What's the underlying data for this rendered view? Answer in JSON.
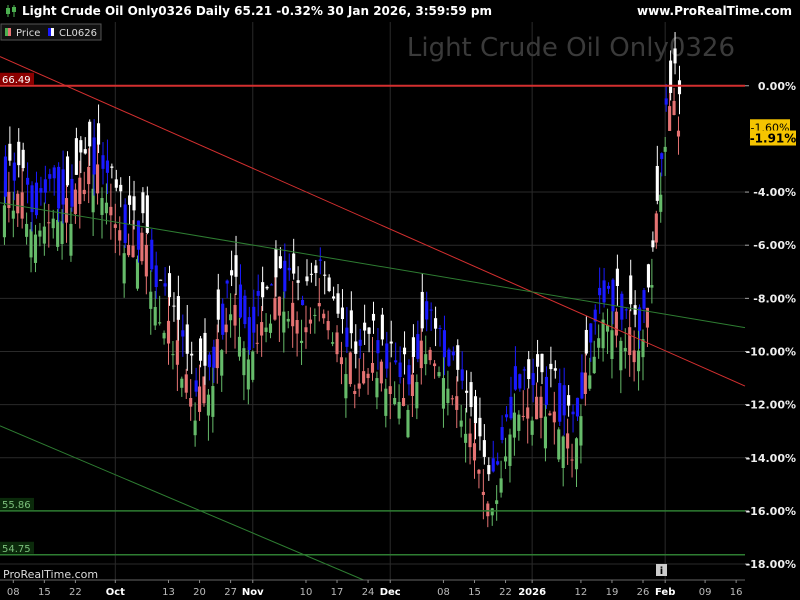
{
  "header": {
    "title": "Light Crude Oil Only0326 Daily 65.21 -0.32% 30 Jan 2026, 3:59:59 pm",
    "site": "www.ProRealTime.com"
  },
  "watermark": "Light Crude Oil Only0326",
  "footer_brand": "ProRealTime.com",
  "info_icon": "i",
  "legend": [
    {
      "label": "Price",
      "color": "#4caf50",
      "icon": "price-swatch"
    },
    {
      "label": "CL0626",
      "color": "#1a1aff",
      "icon": "cl0626-swatch"
    }
  ],
  "colors": {
    "background": "#000000",
    "up_candle": "#66bb6a",
    "down_candle": "#e57373",
    "cl_blue": "#1a1aff",
    "cl_white": "#ffffff",
    "red_line": "#d32f2f",
    "green_line": "#2e7d32",
    "grid": "#2a2a2a",
    "badge": "#f5c400"
  },
  "chart_data": {
    "type": "candlestick",
    "series": [
      {
        "name": "Price"
      },
      {
        "name": "CL0626"
      }
    ],
    "ylim": [
      -18.6,
      2.4
    ],
    "yticks": [
      {
        "v": 0,
        "label": "0.00%"
      },
      {
        "v": -4,
        "label": "-4.00%"
      },
      {
        "v": -6,
        "label": "-6.00%"
      },
      {
        "v": -8,
        "label": "-8.00%"
      },
      {
        "v": -10,
        "label": "-10.00%"
      },
      {
        "v": -12,
        "label": "-12.00%"
      },
      {
        "v": -14,
        "label": "-14.00%"
      },
      {
        "v": -16,
        "label": "-16.00%"
      },
      {
        "v": -18,
        "label": "-18.00%"
      }
    ],
    "ytick_tail": "-",
    "badges": [
      {
        "v": -1.6,
        "label": "-1.60%"
      },
      {
        "v": -1.91,
        "label": "-1.91%"
      }
    ],
    "price_levels": [
      {
        "v": 0,
        "label": "66.49",
        "color": "#d32f2f"
      },
      {
        "v": -16,
        "label": "55.86",
        "color": "#2e7d32"
      },
      {
        "v": -17.65,
        "label": "54.75",
        "color": "#2e7d32"
      }
    ],
    "x_labels": [
      {
        "d": 1,
        "label": "08"
      },
      {
        "d": 8,
        "label": "15"
      },
      {
        "d": 15,
        "label": "22"
      },
      {
        "d": 24,
        "label": "Oct",
        "bold": true
      },
      {
        "d": 36,
        "label": "13"
      },
      {
        "d": 43,
        "label": "20"
      },
      {
        "d": 50,
        "label": "27"
      },
      {
        "d": 55,
        "label": "Nov",
        "bold": true
      },
      {
        "d": 67,
        "label": "10"
      },
      {
        "d": 74,
        "label": "17"
      },
      {
        "d": 81,
        "label": "24"
      },
      {
        "d": 86,
        "label": "Dec",
        "bold": true
      },
      {
        "d": 98,
        "label": "08"
      },
      {
        "d": 105,
        "label": "15"
      },
      {
        "d": 112,
        "label": "22"
      },
      {
        "d": 118,
        "label": "2026",
        "bold": true
      },
      {
        "d": 129,
        "label": "12"
      },
      {
        "d": 136,
        "label": "19"
      },
      {
        "d": 143,
        "label": "26"
      },
      {
        "d": 148,
        "label": "Feb",
        "bold": true
      },
      {
        "d": 157,
        "label": "09"
      },
      {
        "d": 164,
        "label": "16"
      }
    ],
    "x_range": [
      -2,
      166
    ],
    "trendlines": [
      {
        "name": "red",
        "color": "#d32f2f",
        "p1": [
          -2,
          1.1
        ],
        "p2": [
          166,
          -11.3
        ]
      },
      {
        "name": "green-upper",
        "color": "#2e7d32",
        "p1": [
          -2,
          -4.4
        ],
        "p2": [
          166,
          -9.1
        ]
      },
      {
        "name": "green-lower",
        "color": "#2e7d32",
        "p1": [
          -2,
          -12.8
        ],
        "p2": [
          80,
          -18.6
        ]
      }
    ],
    "waypoints": [
      [
        -1,
        -4.5
      ],
      [
        2,
        -4.8
      ],
      [
        6,
        -5.6
      ],
      [
        10,
        -5.0
      ],
      [
        14,
        -5.2
      ],
      [
        18,
        -3.7
      ],
      [
        22,
        -4.4
      ],
      [
        26,
        -6.3
      ],
      [
        30,
        -6.6
      ],
      [
        34,
        -8.9
      ],
      [
        38,
        -10.5
      ],
      [
        42,
        -12.6
      ],
      [
        46,
        -11.3
      ],
      [
        50,
        -8.6
      ],
      [
        54,
        -10.3
      ],
      [
        58,
        -9.1
      ],
      [
        62,
        -8.5
      ],
      [
        66,
        -9.6
      ],
      [
        70,
        -8.3
      ],
      [
        74,
        -10.1
      ],
      [
        78,
        -11.6
      ],
      [
        82,
        -10.8
      ],
      [
        86,
        -11.6
      ],
      [
        90,
        -12.2
      ],
      [
        94,
        -10.1
      ],
      [
        98,
        -11.0
      ],
      [
        102,
        -12.6
      ],
      [
        106,
        -14.6
      ],
      [
        108,
        -16.2
      ],
      [
        110,
        -15.6
      ],
      [
        114,
        -12.3
      ],
      [
        118,
        -12.6
      ],
      [
        122,
        -12.4
      ],
      [
        125,
        -13.2
      ],
      [
        127,
        -14.1
      ],
      [
        130,
        -11.6
      ],
      [
        134,
        -8.8
      ],
      [
        138,
        -9.6
      ],
      [
        141,
        -10.4
      ],
      [
        144,
        -9.1
      ],
      [
        146,
        -5.9
      ],
      [
        148,
        -2.3
      ],
      [
        150,
        -1.1
      ],
      [
        151,
        -1.91
      ]
    ]
  }
}
